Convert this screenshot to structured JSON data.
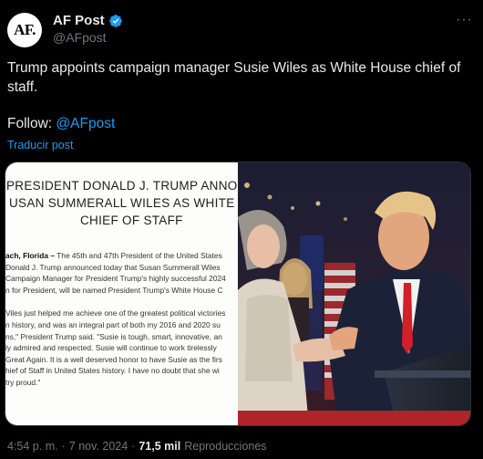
{
  "account": {
    "avatar_text": "AF.",
    "display_name": "AF Post",
    "handle": "@AFpost"
  },
  "tweet": {
    "text": "Trump appoints campaign manager Susie Wiles as White House chief of staff.",
    "follow_label": "Follow:",
    "follow_mention": "@AFpost",
    "translate_label": "Traducir post"
  },
  "media": {
    "document": {
      "title_line1": "PRESIDENT DONALD J. TRUMP ANNOUNCE",
      "title_line2": "USAN SUMMERALL WILES AS WHITE HOUS",
      "title_line3": "CHIEF OF STAFF",
      "dateline": "ach, Florida –",
      "para1_line1": " The 45th and 47th President of the United States",
      "para1_line2": "Donald J. Trump announced today that Susan Summerall Wiles",
      "para1_line3": "Campaign Manager for President Trump's highly successful 2024",
      "para1_line4": "n for President, will be named President Trump's White House C",
      "para2_line1": "Viles just helped me achieve one of the greatest political victories",
      "para2_line2": "n history, and was an integral part of both my 2016 and 2020 su",
      "para2_line3": "ns,\" President Trump said. \"Susie is tough, smart, innovative, an",
      "para2_line4": "ly admired and respected. Susie will continue to work tirelessly",
      "para2_line5": "Great Again. It is a well deserved honor to have Susie as the firs",
      "para2_line6": "hief of Staff in United States history. I have no doubt that she wi",
      "para2_line7": "try proud.\""
    }
  },
  "meta": {
    "time": "4:54 p. m.",
    "sep1": "·",
    "date": "7 nov. 2024",
    "sep2": "·",
    "views": "71,5 mil",
    "views_label": "Reproducciones"
  },
  "colors": {
    "accent": "#1d9bf0",
    "background": "#000000",
    "text": "#e7e9ea",
    "muted": "#71767b"
  }
}
